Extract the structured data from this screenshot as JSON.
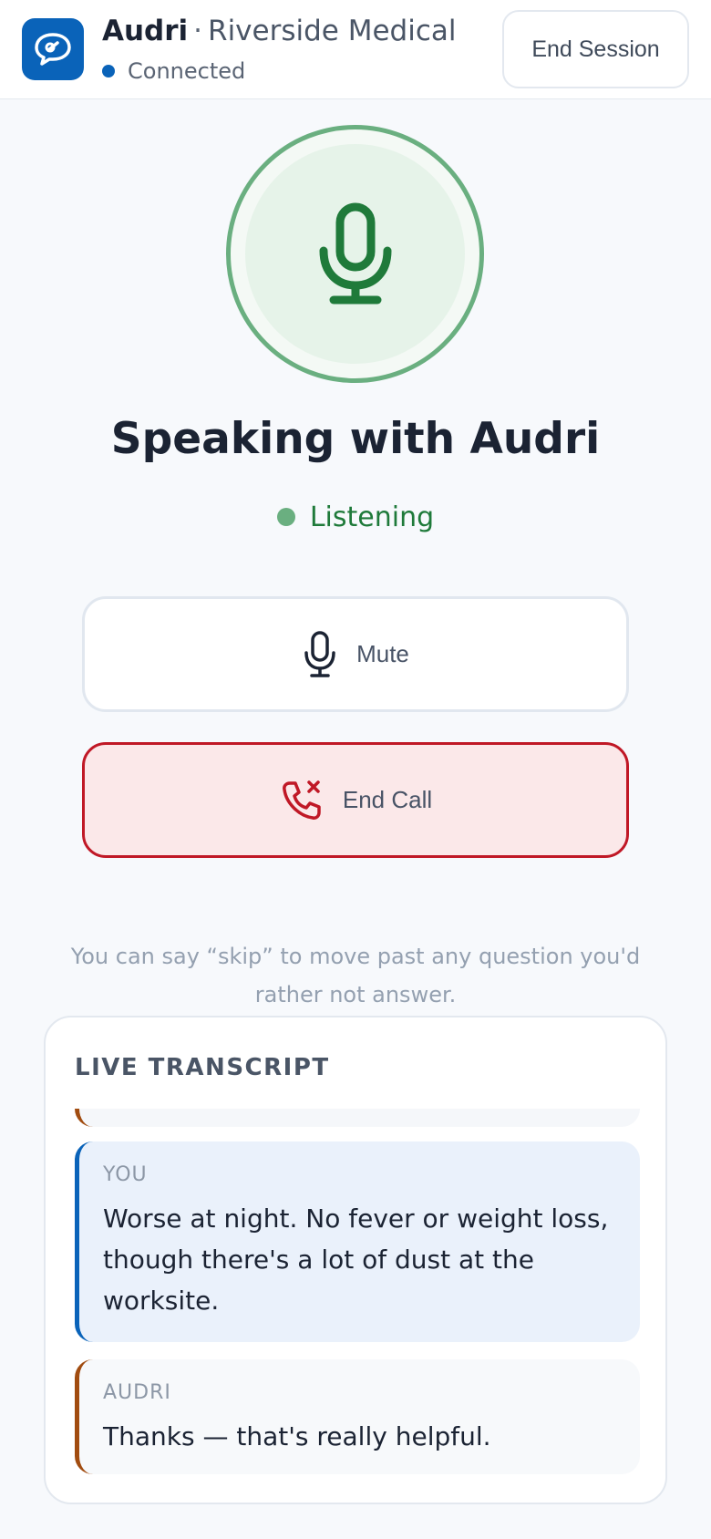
{
  "header": {
    "agent_name": "Audri",
    "separator": "·",
    "org_name": "Riverside Medical",
    "connection_status": "Connected",
    "end_session_label": "End Session",
    "logo_icon": "chat-bubble-icon"
  },
  "call": {
    "title": "Speaking with Audri",
    "status": "Listening",
    "mic_icon": "microphone-icon"
  },
  "controls": {
    "mute_label": "Mute",
    "end_call_label": "End Call"
  },
  "hint": "You can say “skip” to move past any question you'd rather not answer.",
  "transcript": {
    "title": "LIVE TRANSCRIPT",
    "messages": [
      {
        "speaker": "YOU",
        "text": "Worse at night. No fever or weight loss, though there's a lot of dust at the worksite."
      },
      {
        "speaker": "AUDRI",
        "text": "Thanks — that's really helpful."
      }
    ]
  },
  "colors": {
    "brand_blue": "#0a63b9",
    "listening_green": "#1f7a3a",
    "end_call_red": "#c01826",
    "audri_accent": "#a14c10"
  }
}
